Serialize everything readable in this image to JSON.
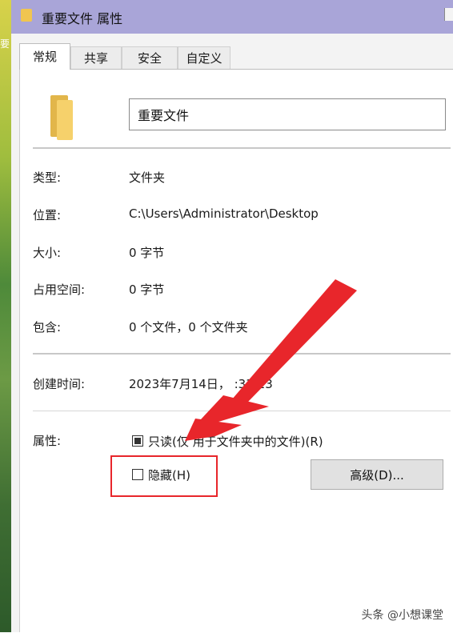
{
  "window": {
    "title": "重要文件 属性"
  },
  "tabs": [
    {
      "label": "常规",
      "active": true
    },
    {
      "label": "共享",
      "active": false
    },
    {
      "label": "安全",
      "active": false
    },
    {
      "label": "自定义",
      "active": false
    }
  ],
  "general": {
    "name_value": "重要文件",
    "rows": {
      "type": {
        "label": "类型:",
        "value": "文件夹"
      },
      "location": {
        "label": "位置:",
        "value": "C:\\Users\\Administrator\\Desktop"
      },
      "size": {
        "label": "大小:",
        "value": "0 字节"
      },
      "size_on_disk": {
        "label": "占用空间:",
        "value": "0 字节"
      },
      "contains": {
        "label": "包含:",
        "value": "0 个文件，0 个文件夹"
      },
      "created": {
        "label": "创建时间:",
        "value": "2023年7月14日，  :33:23"
      }
    },
    "attributes": {
      "label": "属性:",
      "readonly_label": "只读(仅  用于文件夹中的文件)(R)",
      "readonly_state": "indeterminate",
      "hidden_label": "隐藏(H)",
      "hidden_checked": false,
      "advanced_button": "高级(D)..."
    }
  },
  "annotation": {
    "highlight_color": "#e8262b",
    "arrow_color": "#e8262b"
  },
  "watermark": "头条 @小想课堂"
}
